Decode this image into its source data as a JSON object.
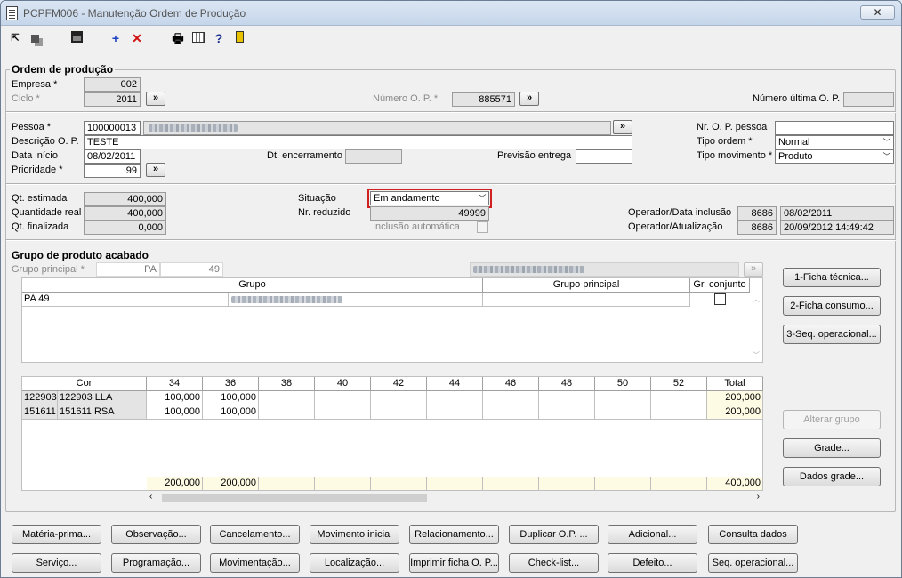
{
  "window": {
    "title": "PCPFM006 - Manutenção Ordem de Produção",
    "close": "✕"
  },
  "toolbar": {
    "print": "🖶",
    "help": "?",
    "add": "+",
    "delete": "✕"
  },
  "ordem": {
    "section": "Ordem de produção",
    "empresa_label": "Empresa *",
    "empresa": "002",
    "ciclo_label": "Ciclo *",
    "ciclo": "2011",
    "numero_op_label": "Número O. P. *",
    "numero_op": "885571",
    "numero_ultima_label": "Número última O. P.",
    "numero_ultima": "",
    "pessoa_label": "Pessoa *",
    "pessoa": "100000013",
    "descricao_label": "Descrição O. P.",
    "descricao": "TESTE",
    "data_inicio_label": "Data início",
    "data_inicio": "08/02/2011",
    "dt_encerramento_label": "Dt. encerramento",
    "dt_encerramento": "",
    "previsao_label": "Previsão entrega",
    "previsao": "",
    "prioridade_label": "Prioridade *",
    "prioridade": "99",
    "nr_op_pessoa_label": "Nr. O. P. pessoa",
    "nr_op_pessoa": "",
    "tipo_ordem_label": "Tipo ordem *",
    "tipo_ordem": "Normal",
    "tipo_mov_label": "Tipo movimento *",
    "tipo_mov": "Produto",
    "arrow": "»"
  },
  "quant": {
    "estimada_label": "Qt. estimada",
    "estimada": "400,000",
    "real_label": "Quantidade real",
    "real": "400,000",
    "finalizada_label": "Qt. finalizada",
    "finalizada": "0,000",
    "situacao_label": "Situação",
    "situacao": "Em andamento",
    "nr_reduzido_label": "Nr. reduzido",
    "nr_reduzido": "49999",
    "inclusao_label": "Inclusão automática",
    "op_inclusao_label": "Operador/Data inclusão",
    "op_inclusao_id": "8686",
    "op_inclusao_data": "08/02/2011",
    "op_atual_label": "Operador/Atualização",
    "op_atual_id": "8686",
    "op_atual_data": "20/09/2012 14:49:42"
  },
  "grupo": {
    "section": "Grupo de produto acabado",
    "principal_label": "Grupo principal *",
    "principal_code": "PA",
    "principal_num": "49",
    "col_grupo": "Grupo",
    "col_principal": "Grupo principal",
    "col_conjunto": "Gr. conjunto",
    "row1": "PA 49"
  },
  "grade": {
    "col_cor": "Cor",
    "sizes": [
      "34",
      "36",
      "38",
      "40",
      "42",
      "44",
      "46",
      "48",
      "50",
      "52"
    ],
    "col_total": "Total",
    "rows": [
      {
        "code": "122903",
        "name": "122903 LLA",
        "v34": "100,000",
        "v36": "100,000",
        "total": "200,000"
      },
      {
        "code": "151611",
        "name": "151611 RSA",
        "v34": "100,000",
        "v36": "100,000",
        "total": "200,000"
      }
    ],
    "sum34": "200,000",
    "sum36": "200,000",
    "sumtotal": "400,000"
  },
  "side_buttons": {
    "ficha_tecnica": "1-Ficha técnica...",
    "ficha_consumo": "2-Ficha consumo...",
    "seq_operacional": "3-Seq. operacional...",
    "alterar_grupo": "Alterar grupo",
    "grade": "Grade...",
    "dados_grade": "Dados grade..."
  },
  "bottom": {
    "row1": [
      "Matéria-prima...",
      "Observação...",
      "Cancelamento...",
      "Movimento inicial",
      "Relacionamento...",
      "Duplicar O.P. ...",
      "Adicional...",
      "Consulta dados"
    ],
    "row2": [
      "Serviço...",
      "Programação...",
      "Movimentação...",
      "Localização...",
      "Imprimir ficha O. P...",
      "Check-list...",
      "Defeito...",
      "Seq. operacional..."
    ]
  }
}
